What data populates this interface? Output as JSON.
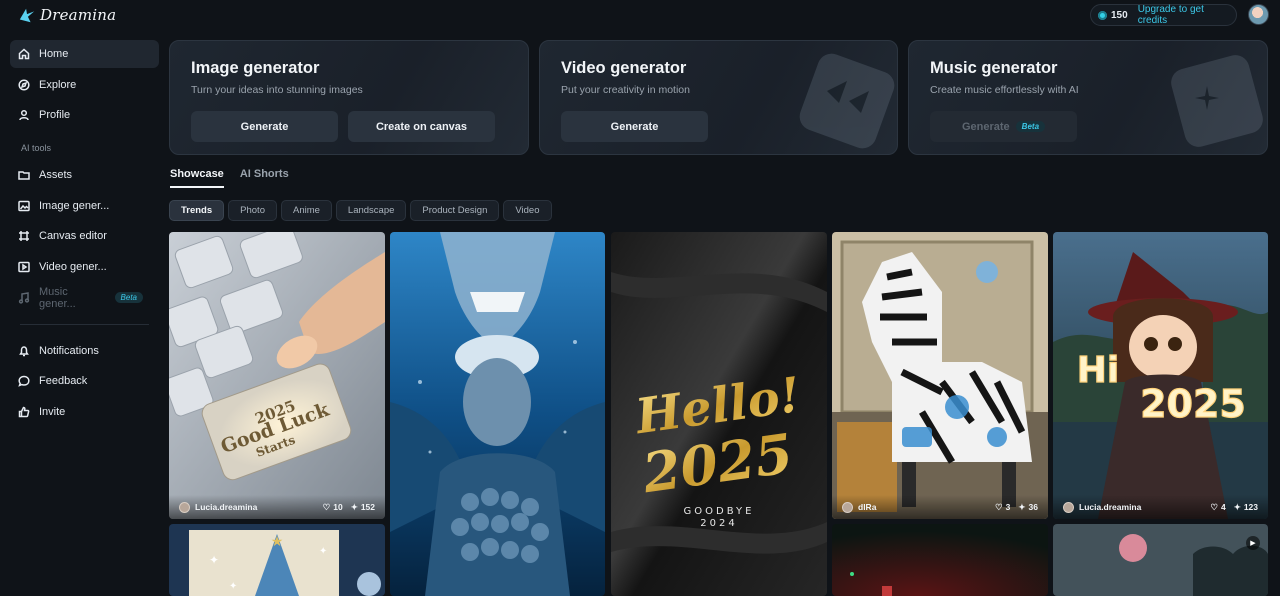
{
  "brand": {
    "name": "Dreamina"
  },
  "credits": {
    "count": "150",
    "upgrade_label": "Upgrade to get credits"
  },
  "sidebar": {
    "items": [
      {
        "label": "Home",
        "icon": "home-icon"
      },
      {
        "label": "Explore",
        "icon": "compass-icon"
      },
      {
        "label": "Profile",
        "icon": "user-icon"
      }
    ],
    "section_label": "AI tools",
    "tools": [
      {
        "label": "Assets",
        "icon": "folder-icon"
      },
      {
        "label": "Image gener...",
        "icon": "image-icon"
      },
      {
        "label": "Canvas editor",
        "icon": "canvas-icon"
      },
      {
        "label": "Video gener...",
        "icon": "video-icon"
      },
      {
        "label": "Music gener...",
        "icon": "music-icon",
        "badge": "Beta"
      }
    ],
    "bottom": [
      {
        "label": "Notifications",
        "icon": "bell-icon"
      },
      {
        "label": "Feedback",
        "icon": "chat-icon"
      },
      {
        "label": "Invite",
        "icon": "thumbs-up-icon"
      }
    ]
  },
  "generators": {
    "image": {
      "title": "Image generator",
      "subtitle": "Turn your ideas into stunning images",
      "btn1": "Generate",
      "btn2": "Create on canvas"
    },
    "video": {
      "title": "Video generator",
      "subtitle": "Put your creativity in motion",
      "btn1": "Generate"
    },
    "music": {
      "title": "Music generator",
      "subtitle": "Create music effortlessly with AI",
      "btn1": "Generate",
      "badge": "Beta"
    }
  },
  "tabs": [
    "Showcase",
    "AI Shorts"
  ],
  "filters": [
    "Trends",
    "Photo",
    "Anime",
    "Landscape",
    "Product Design",
    "Video"
  ],
  "gallery": [
    {
      "author": "Lucia.dreamina",
      "likes": "10",
      "remixes": "152",
      "art_text": [
        "2025",
        "Good Luck",
        "Starts"
      ]
    },
    {
      "author": "",
      "likes": "",
      "remixes": ""
    },
    {
      "art_text": [
        "Hello!",
        "2025",
        "GOODBYE",
        "2024"
      ]
    },
    {
      "author": "dlRa",
      "likes": "3",
      "remixes": "36"
    },
    {
      "author": "Lucia.dreamina",
      "likes": "4",
      "remixes": "123",
      "art_text": [
        "Hi",
        "2025"
      ]
    }
  ],
  "colors": {
    "accent": "#3cc8e8",
    "bg": "#0f1318"
  }
}
